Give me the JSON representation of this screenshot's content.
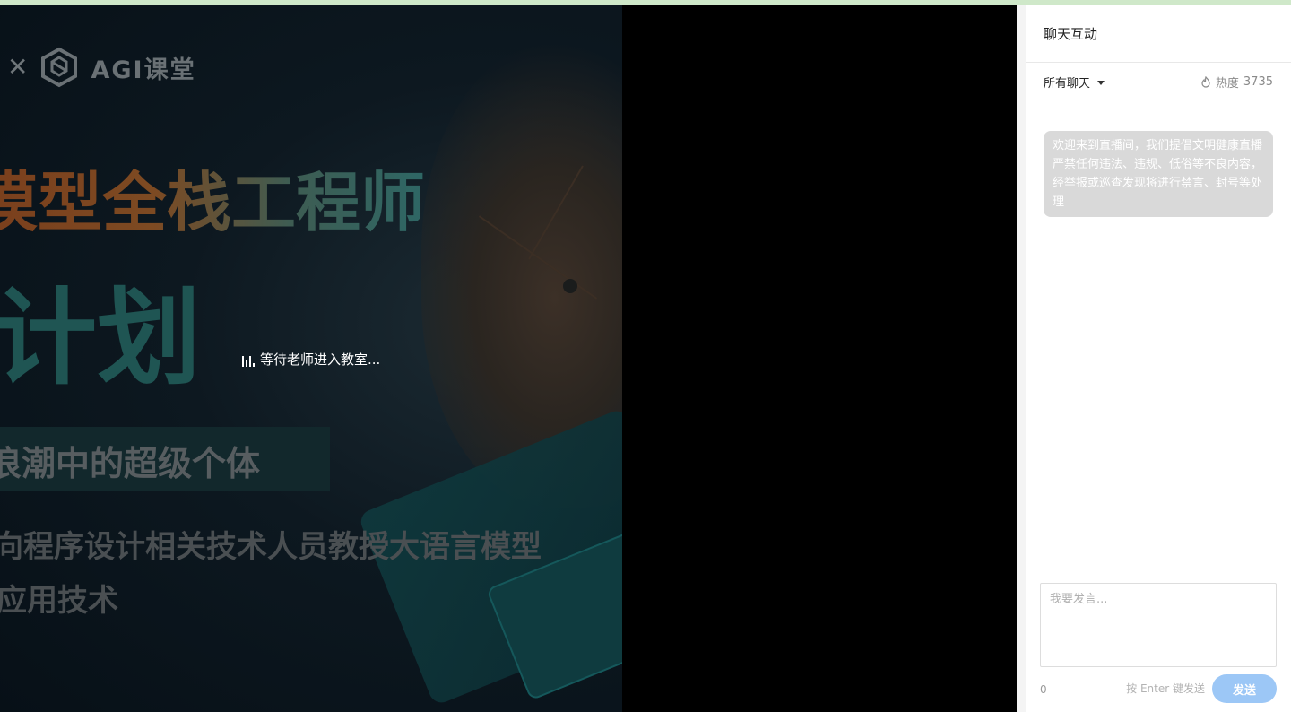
{
  "poster": {
    "logo_text": "AGI课堂",
    "headline": "模型全栈工程师",
    "subheadline": "计划",
    "slogan": "浪潮中的超级个体",
    "description_line1": "向程序设计相关技术人员教授大语言模型",
    "description_line2": "应用技术"
  },
  "stage": {
    "waiting_text": "等待老师进入教室..."
  },
  "chat": {
    "title": "聊天互动",
    "filter_label": "所有聊天",
    "heat_label": "热度",
    "heat_value": "3735",
    "notice": "欢迎来到直播间，我们提倡文明健康直播严禁任何违法、违规、低俗等不良内容，经举报或巡查发现将进行禁言、封号等处理",
    "input_placeholder": "我要发言...",
    "char_count": "0",
    "send_hint": "按 Enter 键发送",
    "send_label": "发送"
  },
  "colors": {
    "send_button": "#9cc7f6",
    "notice_bg": "#d9d9d9",
    "accent_green": "#c9e6c4"
  }
}
